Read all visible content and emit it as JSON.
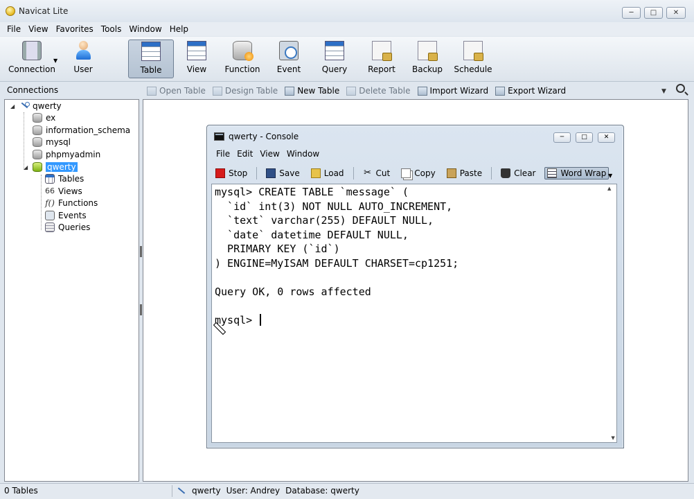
{
  "window": {
    "title": "Navicat Lite",
    "minimize_glyph": "─",
    "maximize_glyph": "□",
    "close_glyph": "✕"
  },
  "menu": [
    "File",
    "View",
    "Favorites",
    "Tools",
    "Window",
    "Help"
  ],
  "toolbar": {
    "items": [
      {
        "label": "Connection",
        "icon": "connection-icon"
      },
      {
        "label": "User",
        "icon": "user-icon"
      },
      {
        "label": "Table",
        "icon": "table-icon",
        "active": true
      },
      {
        "label": "View",
        "icon": "view-icon"
      },
      {
        "label": "Function",
        "icon": "function-icon"
      },
      {
        "label": "Event",
        "icon": "event-icon"
      },
      {
        "label": "Query",
        "icon": "query-icon"
      },
      {
        "label": "Report",
        "icon": "report-icon"
      },
      {
        "label": "Backup",
        "icon": "backup-icon"
      },
      {
        "label": "Schedule",
        "icon": "schedule-icon"
      }
    ]
  },
  "connections_label": "Connections",
  "subtoolbar": [
    {
      "label": "Open Table",
      "enabled": false
    },
    {
      "label": "Design Table",
      "enabled": false
    },
    {
      "label": "New Table",
      "enabled": true
    },
    {
      "label": "Delete Table",
      "enabled": false
    },
    {
      "label": "Import Wizard",
      "enabled": true
    },
    {
      "label": "Export Wizard",
      "enabled": true
    }
  ],
  "tree": {
    "connection": "qwerty",
    "databases": [
      "ex",
      "information_schema",
      "mysql",
      "phpmyadmin",
      "qwerty"
    ],
    "selected_db": "qwerty",
    "children": [
      "Tables",
      "Views",
      "Functions",
      "Events",
      "Queries"
    ]
  },
  "console": {
    "title": "qwerty - Console",
    "menu": [
      "File",
      "Edit",
      "View",
      "Window"
    ],
    "tools": [
      "Stop",
      "Save",
      "Load",
      "Cut",
      "Copy",
      "Paste",
      "Clear",
      "Word Wrap"
    ],
    "lines": [
      "mysql> CREATE TABLE `message` (",
      "  `id` int(3) NOT NULL AUTO_INCREMENT,",
      "  `text` varchar(255) DEFAULT NULL,",
      "  `date` datetime DEFAULT NULL,",
      "  PRIMARY KEY (`id`)",
      ") ENGINE=MyISAM DEFAULT CHARSET=cp1251;",
      "",
      "Query OK, 0 rows affected",
      "",
      "mysql> "
    ]
  },
  "status": {
    "count": "0 Tables",
    "connection": "qwerty",
    "user": "User: Andrey",
    "database": "Database: qwerty"
  }
}
